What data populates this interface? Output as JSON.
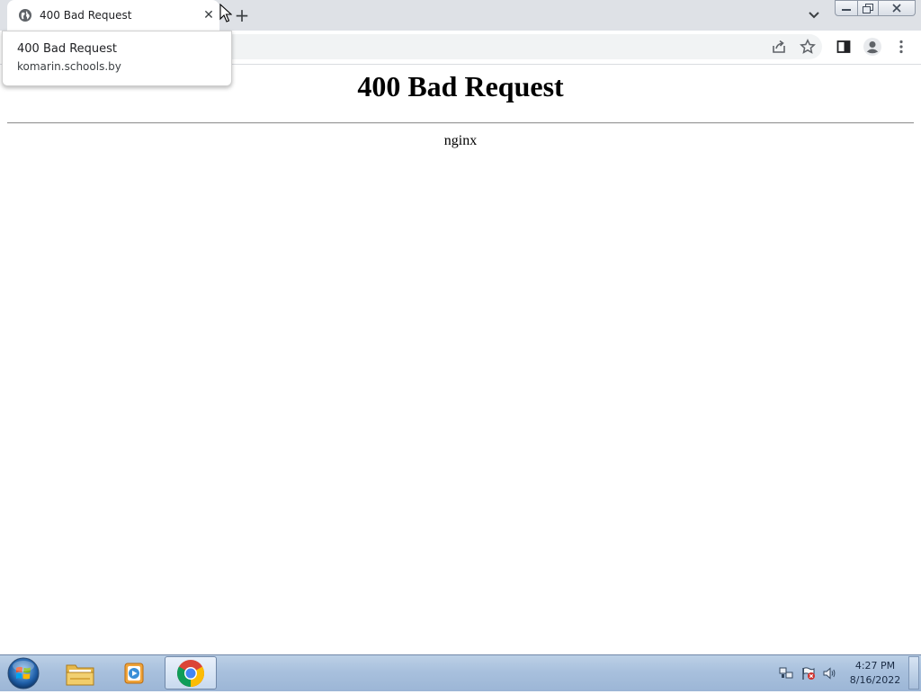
{
  "browser": {
    "tab": {
      "title": "400 Bad Request",
      "close_glyph": "✕"
    },
    "new_tab_glyph": "+",
    "hover_card": {
      "title": "400 Bad Request",
      "url": "komarin.schools.by"
    }
  },
  "page": {
    "heading": "400 Bad Request",
    "server": "nginx"
  },
  "taskbar": {
    "apps": [
      "start-orb",
      "windows-explorer-icon",
      "media-player-icon",
      "chrome-icon"
    ],
    "active_app": "chrome-icon",
    "clock": {
      "time": "4:27 PM",
      "date": "8/16/2022"
    }
  },
  "colors": {
    "tabstrip_bg": "#dee1e6",
    "omnibox_bg": "#f1f3f4",
    "taskbar_bg": "#a8c0dd"
  }
}
